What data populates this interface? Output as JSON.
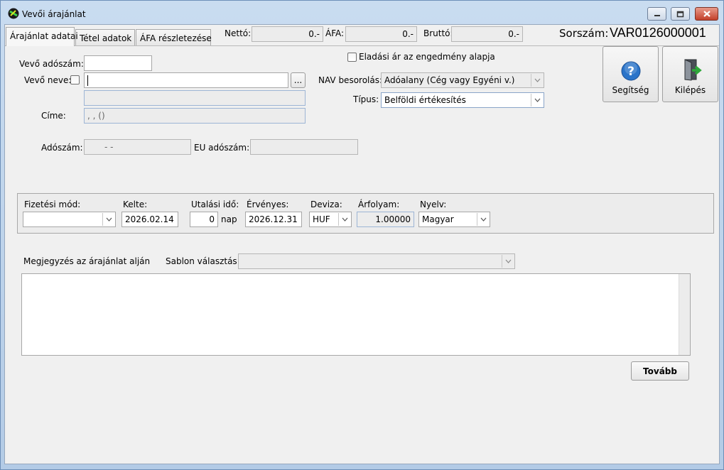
{
  "window": {
    "title": "Vevői árajánlat",
    "colors": {
      "frame": "#b3cbe6",
      "client": "#f0f0f0",
      "close": "#c3402a",
      "help_icon": "#2b74c9"
    }
  },
  "tabs": [
    {
      "label": "Árajánlat adatai",
      "active": true
    },
    {
      "label": "Tétel adatok",
      "active": false
    },
    {
      "label": "ÁFA részletezése",
      "active": false
    }
  ],
  "totals": {
    "net_label": "Nettó:",
    "net_value": "0.-",
    "vat_label": "ÁFA:",
    "vat_value": "0.-",
    "gross_label": "Bruttó:",
    "gross_value": "0.-"
  },
  "serial": {
    "label": "Sorszám:",
    "value": "VAR0126000001"
  },
  "buyer": {
    "tax_label": "Vevő adószám:",
    "tax_value": "",
    "name_label": "Vevő neve:",
    "name_value": "",
    "browse_label": "...",
    "name2_value": "",
    "address_label": "Címe:",
    "address_value": ", ,  ()",
    "taxno_label": "Adószám:",
    "taxno_value": "- -",
    "eu_label": "EU adószám:",
    "eu_value": ""
  },
  "options": {
    "discount_label": "Eladási ár az engedmény alapja",
    "nav_label": "NAV besorolás:",
    "nav_value": "Adóalany (Cég vagy Egyéni v.)",
    "type_label": "Típus:",
    "type_value": "Belföldi értékesítés"
  },
  "buttons": {
    "help_label": "Segítség",
    "exit_label": "Kilépés",
    "next_label": "Tovább"
  },
  "payment": {
    "method_label": "Fizetési mód:",
    "method_value": "",
    "date_label": "Kelte:",
    "date_value": "2026.02.14",
    "term_label": "Utalási idő:",
    "term_value": "0",
    "term_unit": "nap",
    "valid_label": "Érvényes:",
    "valid_value": "2026.12.31",
    "currency_label": "Deviza:",
    "currency_value": "HUF",
    "rate_label": "Árfolyam:",
    "rate_value": "1.00000",
    "lang_label": "Nyelv:",
    "lang_value": "Magyar"
  },
  "notes": {
    "label": "Megjegyzés az árajánlat alján",
    "template_label": "Sablon választás:",
    "template_value": "",
    "text": ""
  }
}
